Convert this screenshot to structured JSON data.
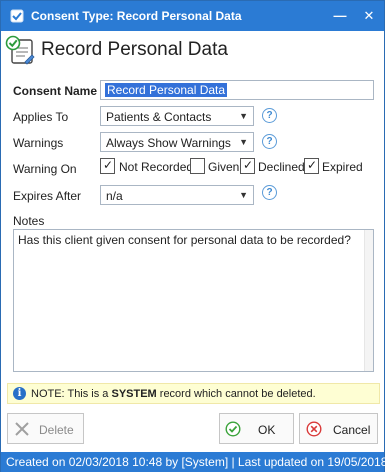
{
  "window": {
    "title": "Consent Type: Record Personal Data",
    "minimize_glyph": "—",
    "close_glyph": "✕"
  },
  "header": {
    "title": "Record Personal Data"
  },
  "form": {
    "consent_name_label": "Consent Name",
    "consent_name_value": "Record Personal Data",
    "applies_to_label": "Applies To",
    "applies_to_value": "Patients & Contacts",
    "warnings_label": "Warnings",
    "warnings_value": "Always Show Warnings",
    "warning_on_label": "Warning On",
    "warning_on_options": [
      {
        "label": "Not Recorded",
        "checked": true
      },
      {
        "label": "Given",
        "checked": false
      },
      {
        "label": "Declined",
        "checked": true
      },
      {
        "label": "Expired",
        "checked": true
      }
    ],
    "expires_after_label": "Expires After",
    "expires_after_value": "n/a",
    "notes_label": "Notes",
    "notes_value": "Has this client given consent for personal data to be recorded?"
  },
  "notice": {
    "prefix": "NOTE: This is a ",
    "emphasis": "SYSTEM",
    "suffix": " record which cannot be deleted."
  },
  "buttons": {
    "delete_label": "Delete",
    "ok_label": "OK",
    "cancel_label": "Cancel"
  },
  "status_bar": {
    "text": "Created on 02/03/2018 10:48 by [System] | Last updated on 19/05/2018"
  },
  "icons": {
    "help": "?",
    "check": "✓",
    "caret": "▼",
    "info": "i"
  },
  "colors": {
    "title_bar": "#2b7bd4",
    "selection": "#3371d9",
    "notice_bg": "#fefed3",
    "ok_green": "#3aa33a",
    "cancel_red": "#d93a3a"
  }
}
